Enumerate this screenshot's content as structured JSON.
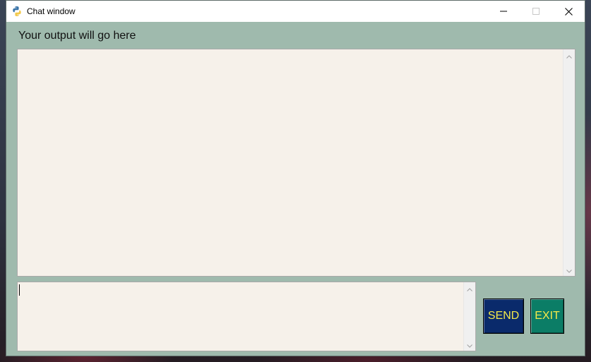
{
  "window": {
    "title": "Chat window"
  },
  "output": {
    "label": "Your output will go here",
    "text": ""
  },
  "input": {
    "text": ""
  },
  "buttons": {
    "send_label": "SEND",
    "exit_label": "EXIT"
  },
  "icons": {
    "app": "python-icon",
    "minimize": "minimize-icon",
    "maximize": "maximize-icon",
    "close": "close-icon",
    "scroll_up": "chevron-up-icon",
    "scroll_down": "chevron-down-icon"
  },
  "colors": {
    "window_background": "#9fbaad",
    "text_area_background": "#f6f1ea",
    "send_button": "#0a2a6b",
    "exit_button": "#0b7d66",
    "button_text": "#f5e94a"
  }
}
